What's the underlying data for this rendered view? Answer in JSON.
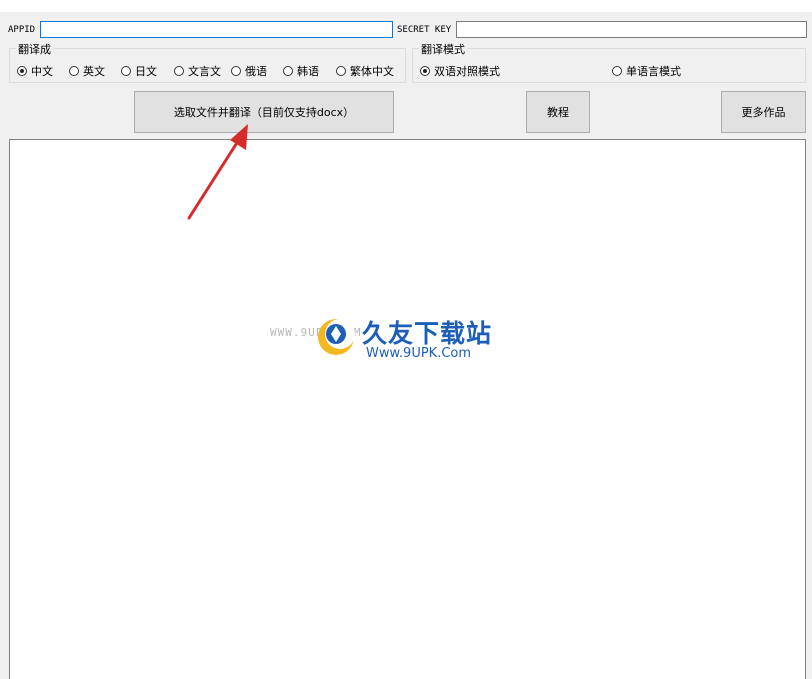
{
  "credentials": {
    "appid_label": "APPID",
    "appid_value": "",
    "secret_label": "SECRET KEY",
    "secret_value": ""
  },
  "target_language": {
    "legend": "翻译成",
    "options": [
      "中文",
      "英文",
      "日文",
      "文言文",
      "俄语",
      "韩语",
      "繁体中文"
    ],
    "selected": "中文"
  },
  "mode": {
    "legend": "翻译模式",
    "options": [
      "双语对照模式",
      "单语言模式"
    ],
    "selected": "双语对照模式"
  },
  "buttons": {
    "select_translate": "选取文件并翻译（目前仅支持docx）",
    "tutorial": "教程",
    "more_works": "更多作品"
  },
  "output": {
    "text": ""
  },
  "watermark": {
    "small_text": "WWW.9UPK.COM",
    "title": "久友下载站",
    "url": "Www.9UPK.Com"
  },
  "colors": {
    "accent": "#0078d7",
    "arrow": "#d62b2b",
    "watermark": "#1d5fb8"
  }
}
